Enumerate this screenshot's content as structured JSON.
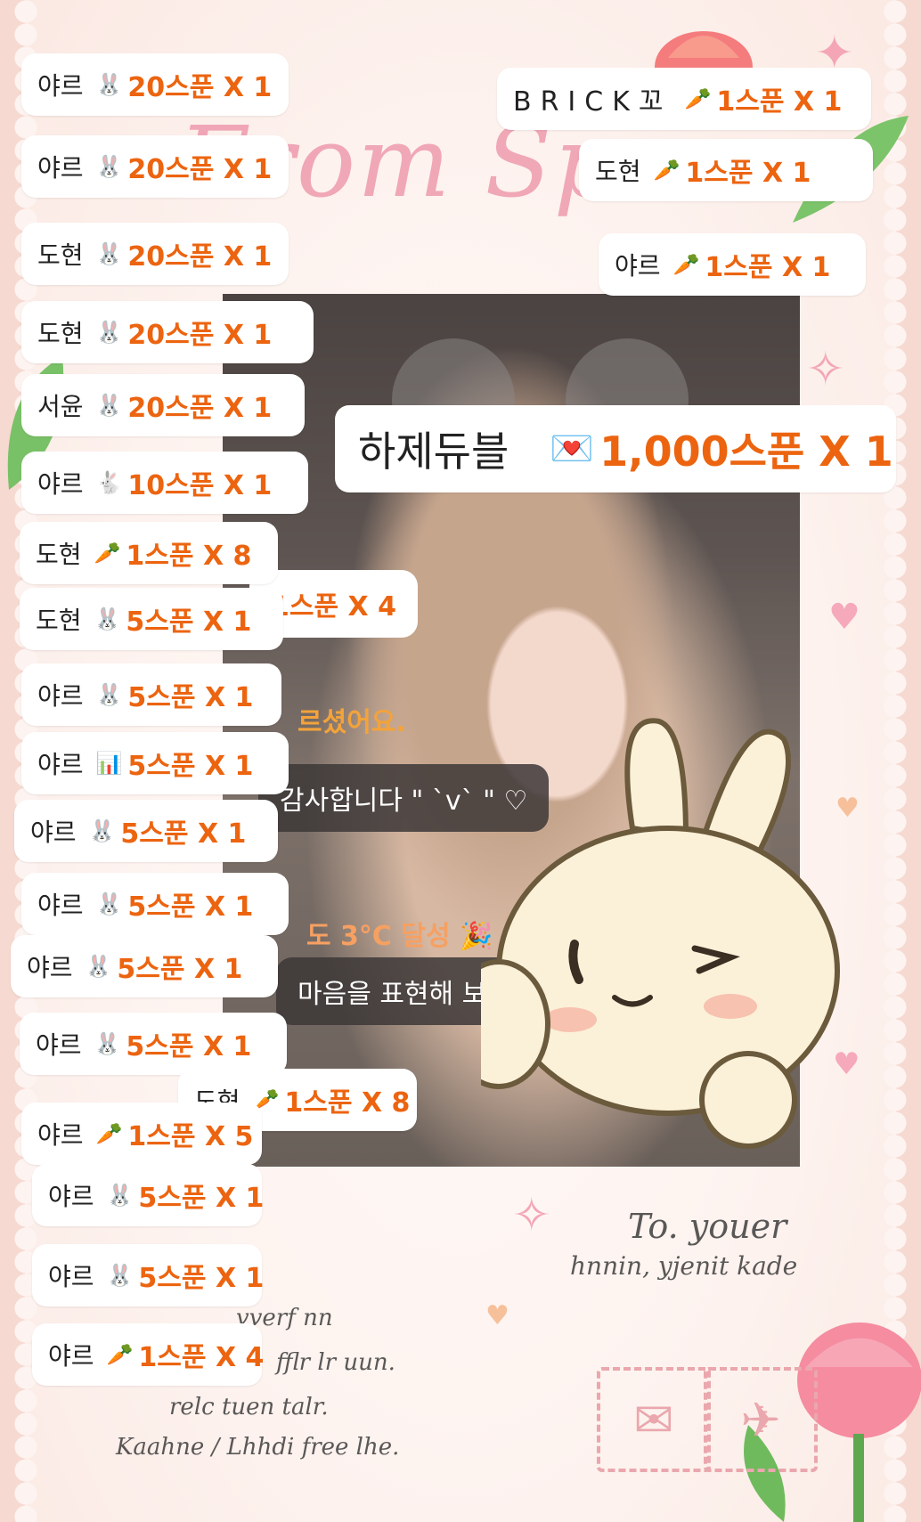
{
  "background": {
    "paper_color": "#fdf2ee",
    "accent_pink": "#ee9aad",
    "gift_amount_color": "#ec6410"
  },
  "card": {
    "title_script": "From Sp",
    "handwriting": {
      "to_line": "To. youer",
      "sub_line": "hnnin, yjenit kade",
      "line1": "vverf nn",
      "line2": "fflr lr uun.",
      "line3": "relc tuen talr.",
      "line4": "Kaahne / Lhhdi free lhe."
    }
  },
  "stream": {
    "chats": [
      {
        "text": "1스푼 X 4"
      },
      {
        "text": "르셨어요."
      },
      {
        "text": "감사합니다 \" `v` \" ♡"
      },
      {
        "text": "도 3°C 달성 🎉"
      },
      {
        "text": "마음을 표현해 보세"
      }
    ]
  },
  "gifts": [
    {
      "sender": "야르",
      "icon": "bunny-balloon-icon",
      "amount": "20스푼 X 1"
    },
    {
      "sender": "BRICK꼬",
      "icon": "carrot-icon",
      "amount": "1스푼 X 1"
    },
    {
      "sender": "야르",
      "icon": "bunny-balloon-icon",
      "amount": "20스푼 X 1"
    },
    {
      "sender": "도현",
      "icon": "carrot-icon",
      "amount": "1스푼 X 1"
    },
    {
      "sender": "도현",
      "icon": "bunny-balloon-icon",
      "amount": "20스푼 X 1"
    },
    {
      "sender": "야르",
      "icon": "carrot-icon",
      "amount": "1스푼 X 1"
    },
    {
      "sender": "도현",
      "icon": "bunny-balloon-icon",
      "amount": "20스푼 X 1"
    },
    {
      "sender": "서윤",
      "icon": "bunny-balloon-icon",
      "amount": "20스푼 X 1"
    },
    {
      "sender": "하제듀블",
      "icon": "letter-card-icon",
      "amount": "1,000스푼 X 1"
    },
    {
      "sender": "야르",
      "icon": "bunny-icon",
      "amount": "10스푼 X 1"
    },
    {
      "sender": "도현",
      "icon": "carrot-icon",
      "amount": "1스푼 X 8"
    },
    {
      "sender": "도현",
      "icon": "bunny-cheer-icon",
      "amount": "5스푼 X 1"
    },
    {
      "sender": "야르",
      "icon": "bunny-cheer-icon",
      "amount": "5스푼 X 1"
    },
    {
      "sender": "야르",
      "icon": "gift-chart-icon",
      "amount": "5스푼 X 1"
    },
    {
      "sender": "야르",
      "icon": "bunny-cheer-icon",
      "amount": "5스푼 X 1"
    },
    {
      "sender": "야르",
      "icon": "bunny-cheer-icon",
      "amount": "5스푼 X 1"
    },
    {
      "sender": "야르",
      "icon": "bunny-cheer-icon",
      "amount": "5스푼 X 1"
    },
    {
      "sender": "야르",
      "icon": "bunny-cheer-icon",
      "amount": "5스푼 X 1"
    },
    {
      "sender": "도현",
      "icon": "carrot-icon",
      "amount": "1스푼 X 8"
    },
    {
      "sender": "야르",
      "icon": "carrot-icon",
      "amount": "1스푼 X 5"
    },
    {
      "sender": "야르",
      "icon": "bunny-cheer-icon",
      "amount": "5스푼 X 1"
    },
    {
      "sender": "야르",
      "icon": "bunny-cheer-icon",
      "amount": "5스푼 X 1"
    },
    {
      "sender": "야르",
      "icon": "carrot-icon",
      "amount": "1스푼 X 4"
    }
  ]
}
